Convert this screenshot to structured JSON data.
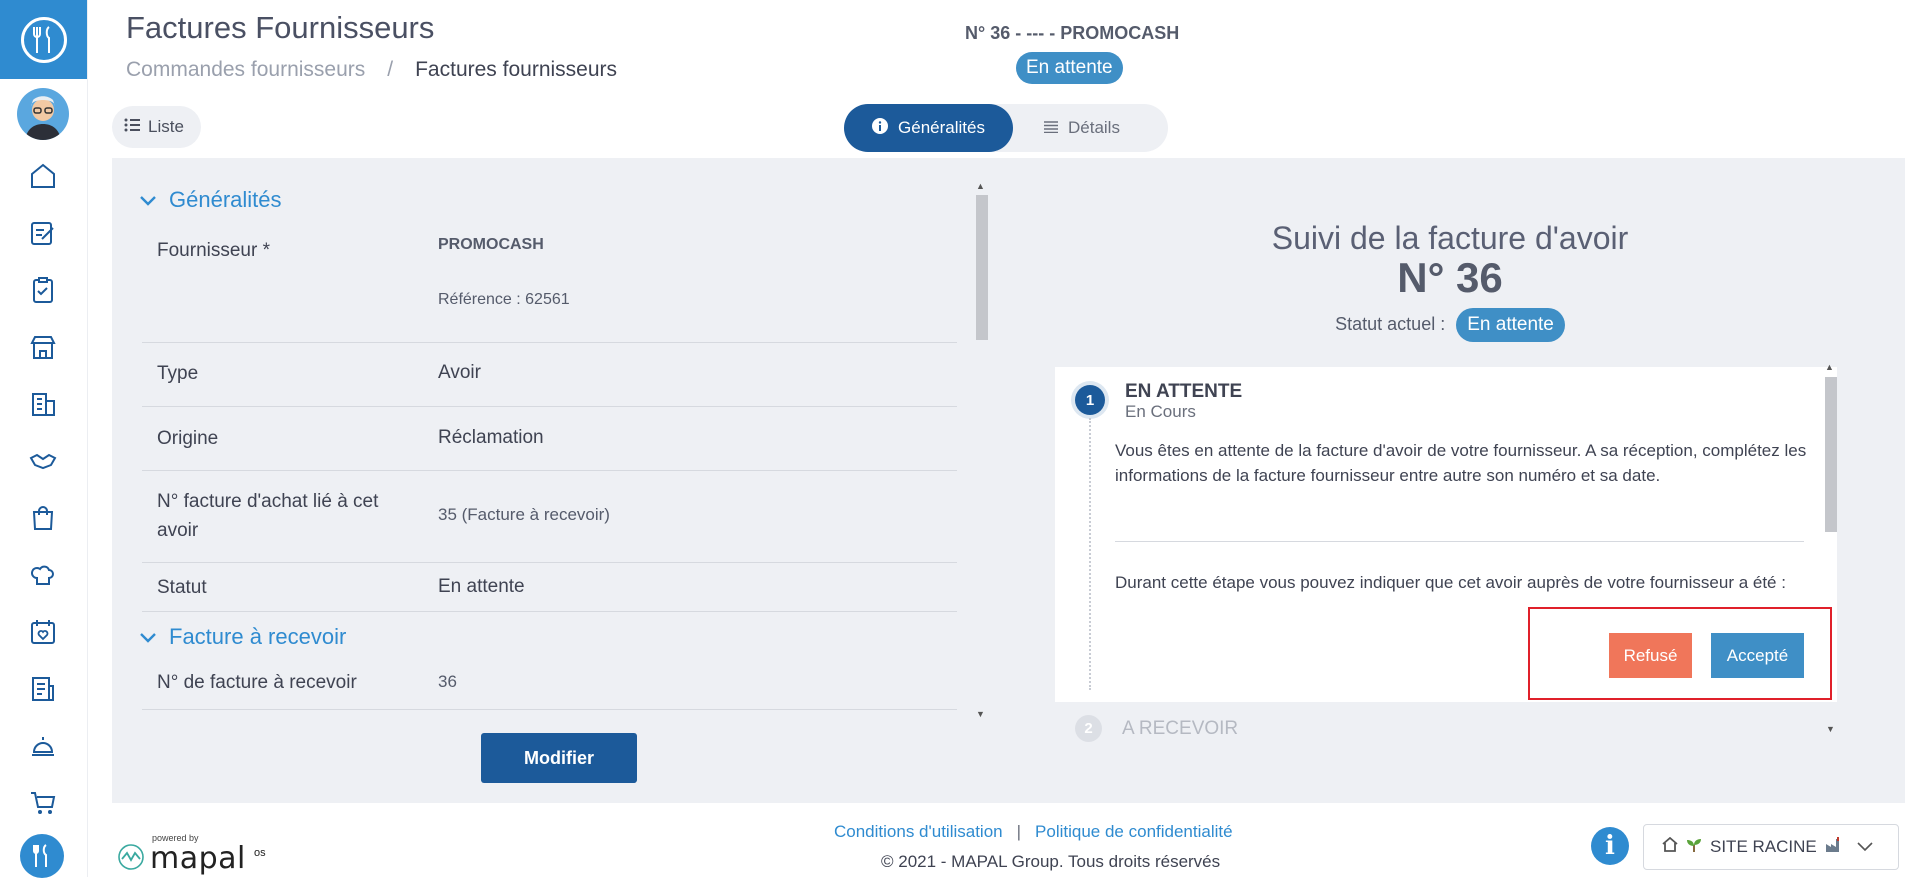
{
  "header": {
    "title": "Factures Fournisseurs",
    "breadcrumb": [
      "Commandes fournisseurs",
      "Factures fournisseurs"
    ],
    "breadcrumb_separator": "/",
    "doc_ref": "N° 36 - --- - PROMOCASH",
    "status_badge": "En attente"
  },
  "toolbar": {
    "list_label": "Liste",
    "tabs": [
      {
        "label": "Généralités",
        "active": true,
        "icon": "info-icon"
      },
      {
        "label": "Détails",
        "active": false,
        "icon": "list-lines-icon"
      }
    ]
  },
  "form": {
    "section_general": "Généralités",
    "rows": [
      {
        "label": "Fournisseur *",
        "value": "PROMOCASH",
        "sub": "Référence : 62561"
      },
      {
        "label": "Type",
        "value": "Avoir"
      },
      {
        "label": "Origine",
        "value": "Réclamation"
      },
      {
        "label": "N° facture d'achat lié à cet avoir",
        "value": "35 (Facture à recevoir)"
      },
      {
        "label": "Statut",
        "value": "En attente"
      }
    ],
    "section_invoice": "Facture à recevoir",
    "invoice_row": {
      "label": "N° de facture à recevoir",
      "value": "36"
    },
    "modify_button": "Modifier"
  },
  "tracking": {
    "title": "Suivi de la facture d'avoir",
    "number": "N° 36",
    "current_status_label": "Statut actuel :",
    "current_status": "En attente",
    "steps": [
      {
        "num": "1",
        "title": "EN ATTENTE",
        "subtitle": "En Cours",
        "text1": "Vous êtes en attente de la facture d'avoir de votre fournisseur. A sa réception, complétez les informations de la facture fournisseur entre autre son numéro et sa date.",
        "text2": "Durant cette étape vous pouvez indiquer que cet avoir auprès de votre fournisseur a été :",
        "refuse_button": "Refusé",
        "accept_button": "Accepté"
      },
      {
        "num": "2",
        "title": "A RECEVOIR"
      }
    ]
  },
  "footer": {
    "powered_by": "powered by",
    "brand": "mapal",
    "brand_suffix": "os",
    "terms_link": "Conditions d'utilisation",
    "privacy_link": "Politique de confidentialité",
    "link_separator": "|",
    "copyright": "© 2021 - MAPAL Group. Tous droits réservés",
    "site_selector": "SITE RACINE"
  },
  "colors": {
    "primary": "#1c5a9a",
    "accent": "#2f8bd0",
    "badge": "#3f8fc6",
    "refuse": "#f0765a",
    "highlight": "#e0202a"
  },
  "sidebar": {
    "icons": [
      "home-icon",
      "edit-note-icon",
      "clipboard-check-icon",
      "store-icon",
      "building-icon",
      "handshake-icon",
      "shopping-bag-icon",
      "chef-hat-icon",
      "calendar-heart-icon",
      "document-list-icon",
      "bell-service-icon",
      "cart-icon"
    ]
  }
}
